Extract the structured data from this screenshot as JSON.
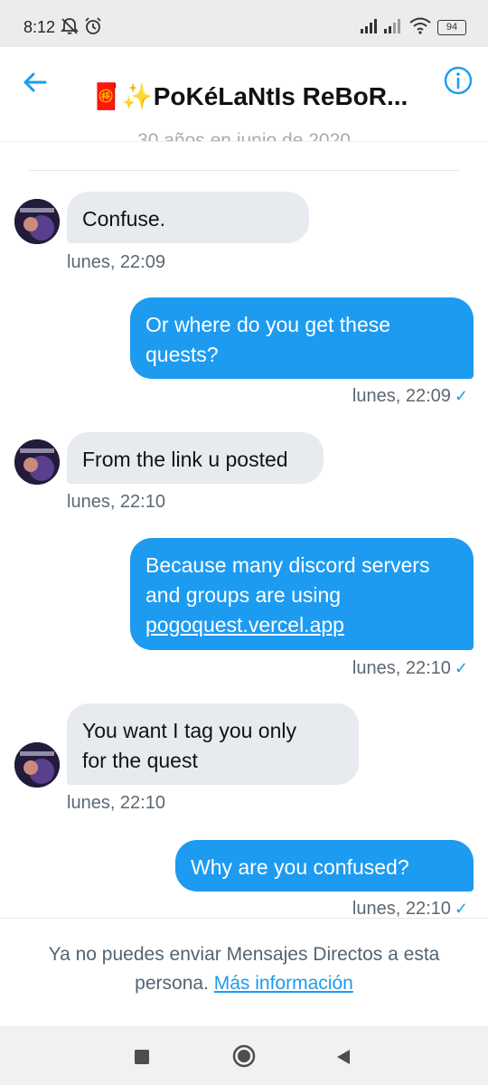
{
  "status_bar": {
    "time": "8:12",
    "battery": "94"
  },
  "header": {
    "title": "🧧✨PoKéLaNtIs ReBoR..."
  },
  "faded_date": "30 años en junio de 2020",
  "messages": [
    {
      "side": "in",
      "lines": [
        "Confuse."
      ],
      "time": "lunes, 22:09"
    },
    {
      "side": "out",
      "lines": [
        "Or where do you get these",
        "quests?"
      ],
      "time": "lunes, 22:09"
    },
    {
      "side": "in",
      "lines": [
        "From the link u posted"
      ],
      "time": "lunes, 22:10"
    },
    {
      "side": "out",
      "lines": [
        "Because many discord servers",
        "and groups are using"
      ],
      "link": "pogoquest.vercel.app",
      "time": "lunes, 22:10"
    },
    {
      "side": "in",
      "lines": [
        "You want I tag you only",
        "for the quest"
      ],
      "time": "lunes, 22:10"
    },
    {
      "side": "out",
      "lines": [
        "Why are you confused?"
      ],
      "time": "lunes, 22:10"
    }
  ],
  "footer": {
    "notice": "Ya no puedes enviar Mensajes Directos a esta persona.",
    "link": "Más información"
  },
  "colors": {
    "accent": "#1d9bf0",
    "incoming_bubble": "#e7ebef"
  }
}
